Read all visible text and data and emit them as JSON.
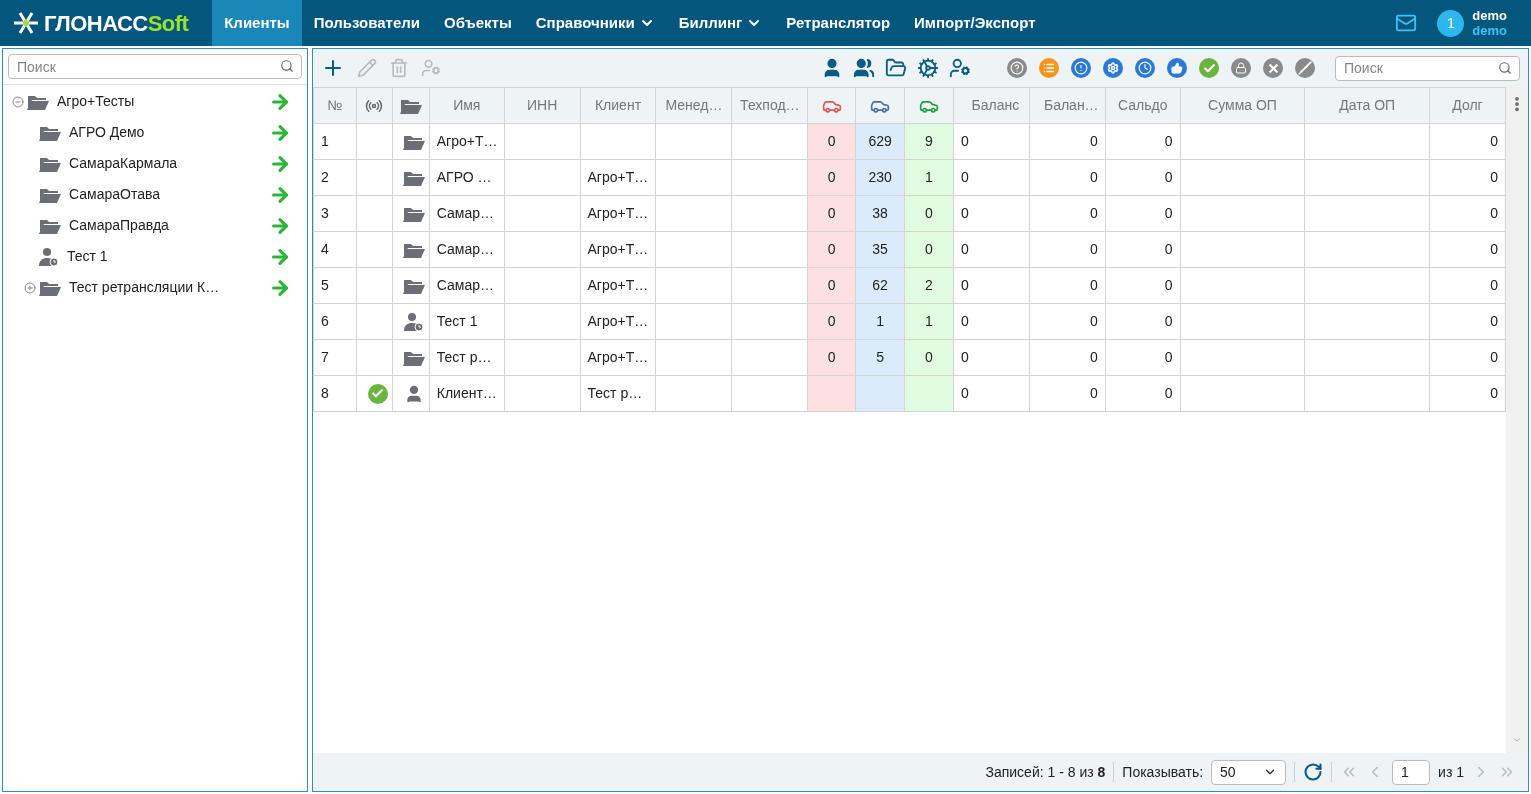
{
  "header": {
    "logo": {
      "main": "ГЛОНАСС",
      "accent": "Soft"
    },
    "nav": [
      {
        "label": "Клиенты",
        "selected": true,
        "dropdown": false
      },
      {
        "label": "Пользователи",
        "selected": false,
        "dropdown": false
      },
      {
        "label": "Объекты",
        "selected": false,
        "dropdown": false
      },
      {
        "label": "Справочники",
        "selected": false,
        "dropdown": true
      },
      {
        "label": "Биллинг",
        "selected": false,
        "dropdown": true
      },
      {
        "label": "Ретранслятор",
        "selected": false,
        "dropdown": false
      },
      {
        "label": "Импорт/Экспорт",
        "selected": false,
        "dropdown": false
      }
    ],
    "notifications": "1",
    "user": {
      "name": "demo",
      "login": "demo"
    }
  },
  "sidebar": {
    "search": {
      "placeholder": "Поиск"
    },
    "tree": [
      {
        "label": "Агро+Тесты",
        "kind": "folder",
        "expanded": true,
        "children": [
          {
            "label": "АГРО Демо",
            "kind": "folder"
          },
          {
            "label": "СамараКармала",
            "kind": "folder"
          },
          {
            "label": "СамараОтава",
            "kind": "folder"
          },
          {
            "label": "СамараПравда",
            "kind": "folder"
          },
          {
            "label": "Тест 1",
            "kind": "user"
          },
          {
            "label": "Тест ретрансляции К…",
            "kind": "folder",
            "expanded": false
          }
        ]
      }
    ]
  },
  "toolbar": {
    "search": {
      "placeholder": "Поиск"
    }
  },
  "table": {
    "columns": [
      "№",
      "",
      "",
      "Имя",
      "ИНН",
      "Клиент",
      "Менед…",
      "Техпод…",
      "",
      "",
      "",
      "Баланс",
      "Балан…",
      "Сальдо",
      "Сумма ОП",
      "Дата ОП",
      "Долг"
    ],
    "rows": [
      {
        "no": "1",
        "online": false,
        "kind": "folder",
        "name": "Агро+Т…",
        "client": "",
        "red": "0",
        "blue": "629",
        "green": "9",
        "balance": "0",
        "balance2": "0",
        "saldo": "0",
        "debt": "0"
      },
      {
        "no": "2",
        "online": false,
        "kind": "folder",
        "name": "АГРО …",
        "client": "Агро+Т…",
        "red": "0",
        "blue": "230",
        "green": "1",
        "balance": "0",
        "balance2": "0",
        "saldo": "0",
        "debt": "0"
      },
      {
        "no": "3",
        "online": false,
        "kind": "folder",
        "name": "Самар…",
        "client": "Агро+Т…",
        "red": "0",
        "blue": "38",
        "green": "0",
        "balance": "0",
        "balance2": "0",
        "saldo": "0",
        "debt": "0"
      },
      {
        "no": "4",
        "online": false,
        "kind": "folder",
        "name": "Самар…",
        "client": "Агро+Т…",
        "red": "0",
        "blue": "35",
        "green": "0",
        "balance": "0",
        "balance2": "0",
        "saldo": "0",
        "debt": "0"
      },
      {
        "no": "5",
        "online": false,
        "kind": "folder",
        "name": "Самар…",
        "client": "Агро+Т…",
        "red": "0",
        "blue": "62",
        "green": "2",
        "balance": "0",
        "balance2": "0",
        "saldo": "0",
        "debt": "0"
      },
      {
        "no": "6",
        "online": false,
        "kind": "user",
        "name": "Тест 1",
        "client": "Агро+Т…",
        "red": "0",
        "blue": "1",
        "green": "1",
        "balance": "0",
        "balance2": "0",
        "saldo": "0",
        "debt": "0"
      },
      {
        "no": "7",
        "online": false,
        "kind": "folder",
        "name": "Тест р…",
        "client": "Агро+Т…",
        "red": "0",
        "blue": "5",
        "green": "0",
        "balance": "0",
        "balance2": "0",
        "saldo": "0",
        "debt": "0"
      },
      {
        "no": "8",
        "online": true,
        "kind": "person",
        "name": "Клиент…",
        "client": "Тест р…",
        "red": "",
        "blue": "",
        "green": "",
        "balance": "0",
        "balance2": "0",
        "saldo": "0",
        "debt": "0"
      }
    ]
  },
  "pager": {
    "records": "Записей: 1 - 8 из **8**",
    "show_label": "Показывать:",
    "page_size": "50",
    "page": "1",
    "of": "из 1"
  }
}
